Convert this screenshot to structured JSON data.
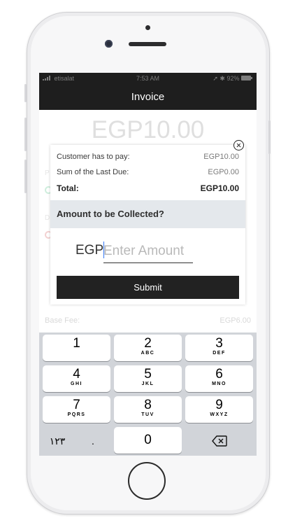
{
  "status": {
    "carrier": "etisalat",
    "time": "7:53 AM",
    "battery": "92%"
  },
  "nav": {
    "title": "Invoice"
  },
  "background": {
    "amount": "EGP10.00",
    "base_fee_label": "Base Fee:",
    "base_fee_value": "EGP6.00"
  },
  "dialog": {
    "rows": [
      {
        "label": "Customer has to pay:",
        "value": "EGP10.00"
      },
      {
        "label": "Sum of the Last Due:",
        "value": "EGP0.00"
      }
    ],
    "total": {
      "label": "Total:",
      "value": "EGP10.00"
    },
    "question": "Amount to be Collected?",
    "currency": "EGP",
    "placeholder": "Enter Amount",
    "submit_label": "Submit"
  },
  "keyboard": {
    "keys": [
      {
        "n": "1",
        "s": ""
      },
      {
        "n": "2",
        "s": "ABC"
      },
      {
        "n": "3",
        "s": "DEF"
      },
      {
        "n": "4",
        "s": "GHI"
      },
      {
        "n": "5",
        "s": "JKL"
      },
      {
        "n": "6",
        "s": "MNO"
      },
      {
        "n": "7",
        "s": "PQRS"
      },
      {
        "n": "8",
        "s": "TUV"
      },
      {
        "n": "9",
        "s": "WXYZ"
      }
    ],
    "arabic_label": "١٢٣",
    "decimal": ".",
    "zero": "0"
  },
  "icons": {
    "close": "close-circle-icon",
    "delete": "backspace-icon"
  }
}
